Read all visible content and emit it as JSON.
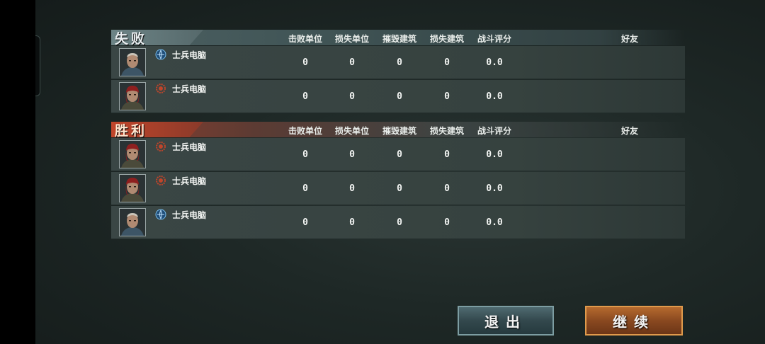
{
  "colors": {
    "defeat_header": "#4c6062",
    "victory_header": "#c0452a",
    "blue_faction": "#5fa6d8",
    "red_faction": "#c0452a"
  },
  "columns": [
    "击败单位",
    "损失单位",
    "摧毁建筑",
    "损失建筑",
    "战斗评分",
    "好友"
  ],
  "defeat": {
    "title": "失败",
    "players": [
      {
        "name": "士兵电脑",
        "faction": "blue-globe-icon",
        "stats": [
          "0",
          "0",
          "0",
          "0",
          "0.0"
        ]
      },
      {
        "name": "士兵电脑",
        "faction": "red-gear-icon",
        "stats": [
          "0",
          "0",
          "0",
          "0",
          "0.0"
        ]
      }
    ]
  },
  "victory": {
    "title": "胜利",
    "players": [
      {
        "name": "士兵电脑",
        "faction": "red-gear-icon",
        "stats": [
          "0",
          "0",
          "0",
          "0",
          "0.0"
        ]
      },
      {
        "name": "士兵电脑",
        "faction": "red-gear-icon",
        "stats": [
          "0",
          "0",
          "0",
          "0",
          "0.0"
        ]
      },
      {
        "name": "士兵电脑",
        "faction": "blue-globe-icon",
        "stats": [
          "0",
          "0",
          "0",
          "0",
          "0.0"
        ]
      }
    ]
  },
  "buttons": {
    "exit": "退出",
    "continue": "继续"
  }
}
